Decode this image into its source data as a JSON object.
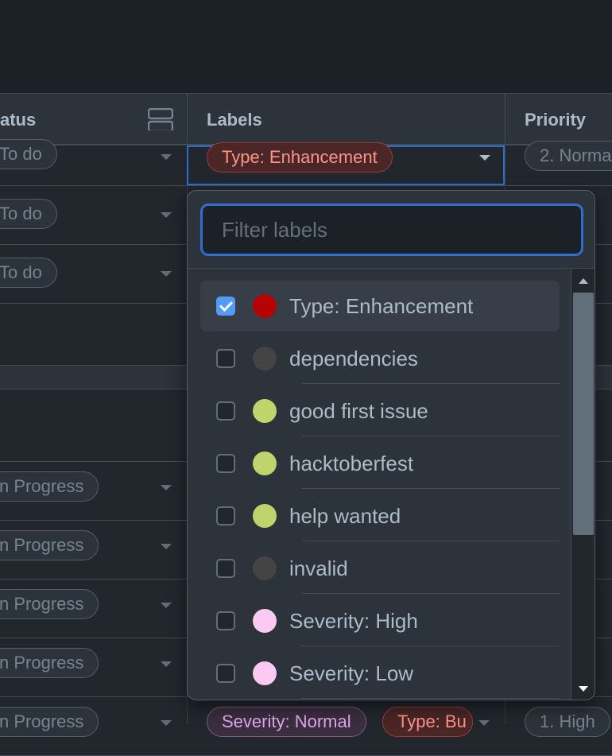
{
  "header": {
    "status_label": "atus",
    "labels_label": "Labels",
    "priority_label": "Priority"
  },
  "rows": [
    {
      "status": "To do",
      "priority": "2. Norma"
    },
    {
      "status": "To do"
    },
    {
      "status": "To do"
    },
    {
      "status": "n Progress"
    },
    {
      "status": "n Progress"
    },
    {
      "status": "n Progress"
    },
    {
      "status": "n Progress"
    },
    {
      "status": "n Progress",
      "labels": [
        "Severity: Normal",
        "Type: Bu"
      ],
      "priority": "1. High"
    }
  ],
  "active_cell": {
    "label": "Type: Enhancement"
  },
  "dropdown": {
    "filter_placeholder": "Filter labels",
    "items": [
      {
        "name": "Type: Enhancement",
        "checked": true,
        "color": "#b60205"
      },
      {
        "name": "dependencies",
        "checked": false,
        "color": "#444444"
      },
      {
        "name": "good first issue",
        "checked": false,
        "color": "#bfd56b"
      },
      {
        "name": "hacktoberfest",
        "checked": false,
        "color": "#bfd56b"
      },
      {
        "name": "help wanted",
        "checked": false,
        "color": "#bfd56b"
      },
      {
        "name": "invalid",
        "checked": false,
        "color": "#444444"
      },
      {
        "name": "Severity: High",
        "checked": false,
        "color": "#fbc9f1"
      },
      {
        "name": "Severity: Low",
        "checked": false,
        "color": "#fbc9f1"
      }
    ]
  },
  "colors": {
    "accent": "#316dca",
    "enhancement_text": "#ff938a",
    "enhancement_bg": "#5a2a2a"
  }
}
